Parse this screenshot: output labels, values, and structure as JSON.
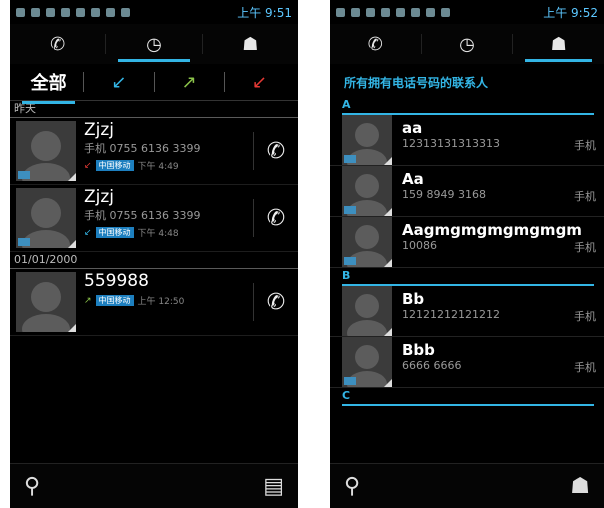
{
  "left": {
    "status": {
      "time": "上午 9:51"
    },
    "filters": {
      "all": "全部",
      "incoming": "↙",
      "outgoing": "↗",
      "missed": "↙"
    },
    "sections": [
      {
        "label": "昨天",
        "entries": [
          {
            "name": "Zjzj",
            "number": "手机 0755 6136 3399",
            "carrier": "中国移动",
            "time": "下午 4:49",
            "direction": "missed"
          },
          {
            "name": "Zjzj",
            "number": "手机 0755 6136 3399",
            "carrier": "中国移动",
            "time": "下午 4:48",
            "direction": "incoming"
          }
        ]
      },
      {
        "label": "01/01/2000",
        "entries": [
          {
            "name": "559988",
            "number": "",
            "carrier": "中国移动",
            "time": "上午 12:50",
            "direction": "outgoing"
          }
        ]
      }
    ]
  },
  "right": {
    "status": {
      "time": "上午 9:52"
    },
    "header": "所有拥有电话号码的联系人",
    "groups": [
      {
        "letter": "A",
        "contacts": [
          {
            "name": "aa",
            "number": "12313131313313",
            "type": "手机"
          },
          {
            "name": "Aa",
            "number": "159 8949 3168",
            "type": "手机"
          },
          {
            "name": "Aagmgmgmgmgmgm",
            "number": "10086",
            "type": "手机"
          }
        ]
      },
      {
        "letter": "B",
        "contacts": [
          {
            "name": "Bb",
            "number": "12121212121212",
            "type": "手机"
          },
          {
            "name": "Bbb",
            "number": "6666 6666",
            "type": "手机"
          }
        ]
      },
      {
        "letter": "C",
        "contacts": []
      }
    ]
  },
  "colors": {
    "accent": "#33b5e5",
    "missed": "#e53935",
    "outgoing": "#8bc34a",
    "incoming": "#33b5e5"
  }
}
